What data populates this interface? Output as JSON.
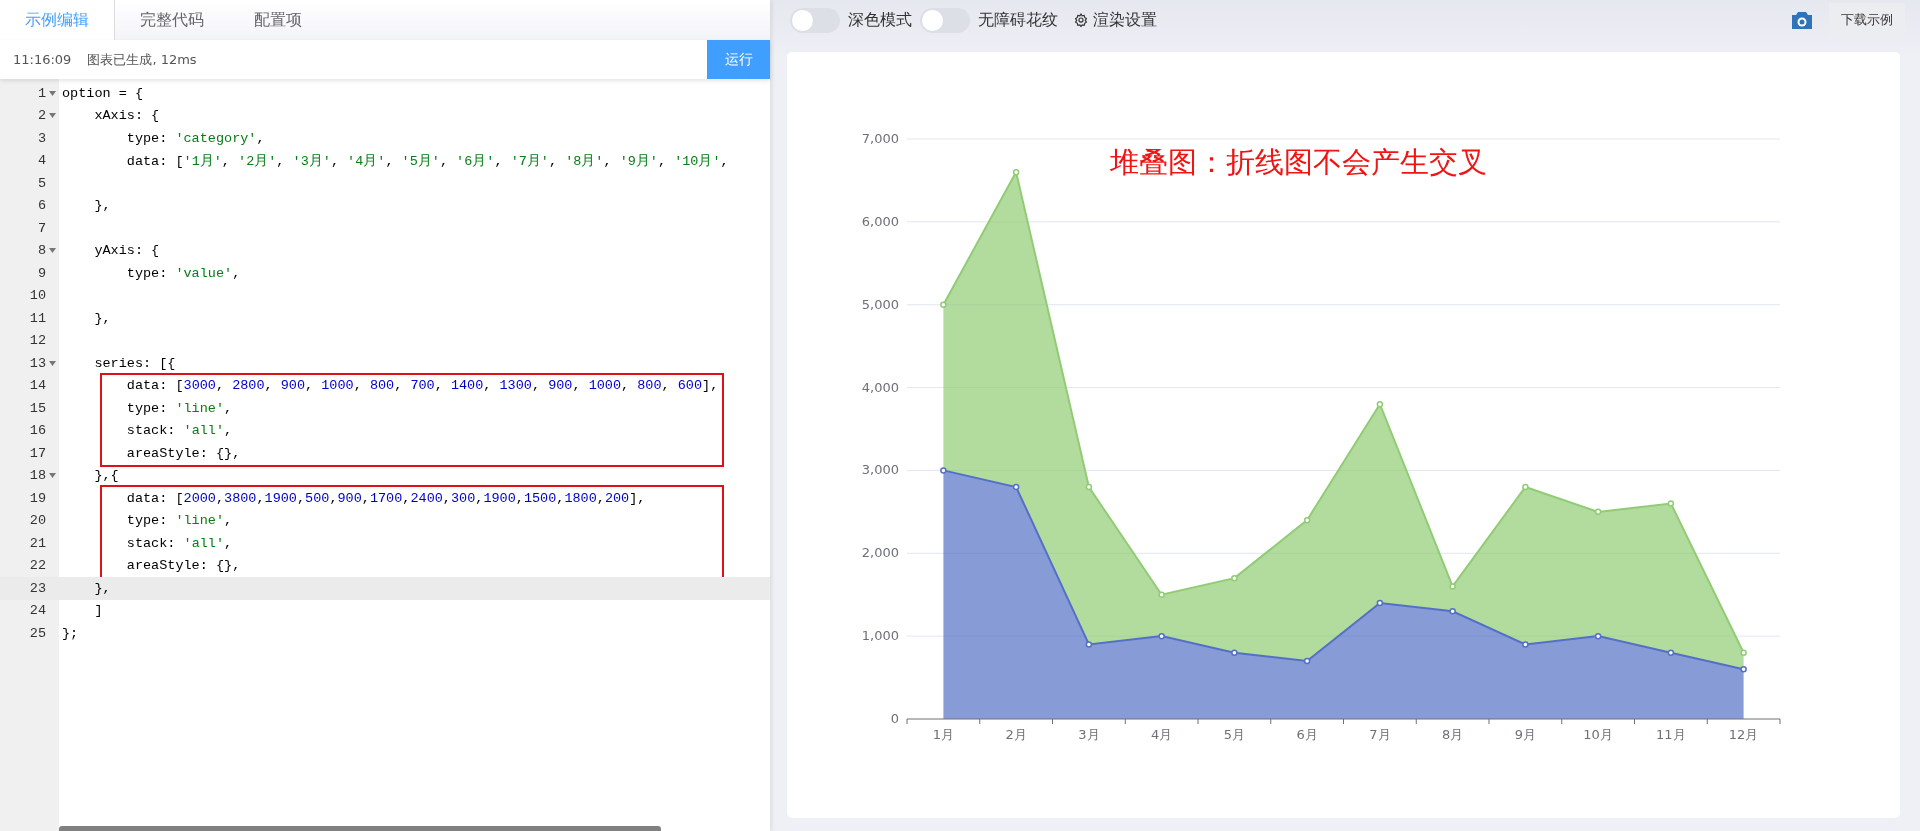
{
  "editor_tabs": [
    {
      "label": "示例编辑",
      "selected": true
    },
    {
      "label": "完整代码",
      "selected": false
    },
    {
      "label": "配置项",
      "selected": false
    }
  ],
  "status": {
    "time": "11:16:09",
    "message": "图表已生成, 12ms"
  },
  "run_button": "运行",
  "code_blocks": [
    {
      "boxed": false,
      "lines": [
        {
          "number": "1",
          "text": "option = {",
          "foldable": true,
          "current": false
        },
        {
          "number": "2",
          "text": "    xAxis: {",
          "foldable": true,
          "current": false
        },
        {
          "number": "3",
          "text": "        type: 'category',",
          "foldable": false,
          "current": false
        },
        {
          "number": "4",
          "text": "        data: ['1月', '2月', '3月', '4月', '5月', '6月', '7月', '8月', '9月', '10月',",
          "foldable": false,
          "current": false
        },
        {
          "number": "5",
          "foldable": false,
          "current": false
        },
        {
          "number": "6",
          "text": "    },",
          "foldable": false,
          "current": false
        },
        {
          "number": "7",
          "foldable": false,
          "current": false
        },
        {
          "number": "8",
          "text": "    yAxis: {",
          "foldable": true,
          "current": false
        },
        {
          "number": "9",
          "text": "        type: 'value',",
          "foldable": false,
          "current": false
        },
        {
          "number": "10",
          "foldable": false,
          "current": false
        },
        {
          "number": "11",
          "text": "    },",
          "foldable": false,
          "current": false
        },
        {
          "number": "12",
          "foldable": false,
          "current": false
        },
        {
          "number": "13",
          "text": "    series: [{",
          "foldable": true,
          "current": false
        }
      ]
    },
    {
      "boxed": true,
      "lines": [
        {
          "number": "14",
          "text": "        data: [3000, 2800, 900, 1000, 800, 700, 1400, 1300, 900, 1000, 800, 600],",
          "foldable": false,
          "current": false
        },
        {
          "number": "15",
          "text": "        type: 'line',",
          "foldable": false,
          "current": false
        },
        {
          "number": "16",
          "text": "        stack: 'all',",
          "foldable": false,
          "current": false
        },
        {
          "number": "17",
          "text": "        areaStyle: {},",
          "foldable": false,
          "current": false
        }
      ]
    },
    {
      "boxed": false,
      "lines": [
        {
          "number": "18",
          "text": "    },{",
          "foldable": true,
          "current": false
        }
      ]
    },
    {
      "boxed": true,
      "lines": [
        {
          "number": "19",
          "text": "        data: [2000,3800,1900,500,900,1700,2400,300,1900,1500,1800,200],",
          "foldable": false,
          "current": false
        },
        {
          "number": "20",
          "text": "        type: 'line',",
          "foldable": false,
          "current": false
        },
        {
          "number": "21",
          "text": "        stack: 'all',",
          "foldable": false,
          "current": false
        },
        {
          "number": "22",
          "text": "        areaStyle: {},",
          "foldable": false,
          "current": false
        }
      ]
    },
    {
      "boxed": false,
      "lines": [
        {
          "number": "23",
          "text": "    },",
          "foldable": false,
          "current": true
        },
        {
          "number": "24",
          "text": "    ]",
          "foldable": false,
          "current": false
        },
        {
          "number": "25",
          "text": "};",
          "foldable": false,
          "current": false
        }
      ]
    }
  ],
  "toolbar": {
    "toggles": [
      {
        "label": "深色模式",
        "on": false
      },
      {
        "label": "无障碍花纹",
        "on": false
      }
    ],
    "render_settings": "渲染设置",
    "download_button": "下载示例"
  },
  "chart_data": {
    "type": "area",
    "title": "堆叠图：折线图不会产生交叉",
    "stacked": true,
    "grid": true,
    "categories": [
      "1月",
      "2月",
      "3月",
      "4月",
      "5月",
      "6月",
      "7月",
      "8月",
      "9月",
      "10月",
      "11月",
      "12月"
    ],
    "series": [
      {
        "color": "#5470c6",
        "values": [
          3000,
          2800,
          900,
          1000,
          800,
          700,
          1400,
          1300,
          900,
          1000,
          800,
          600
        ]
      },
      {
        "color": "#91cc75",
        "values": [
          2000,
          3800,
          1900,
          500,
          900,
          1700,
          2400,
          300,
          1900,
          1500,
          1800,
          200
        ]
      }
    ],
    "ylim": [
      0,
      7000
    ],
    "yticks": [
      {
        "value": 0,
        "label": "0"
      },
      {
        "value": 1000,
        "label": "1,000"
      },
      {
        "value": 2000,
        "label": "2,000"
      },
      {
        "value": 3000,
        "label": "3,000"
      },
      {
        "value": 4000,
        "label": "4,000"
      },
      {
        "value": 5000,
        "label": "5,000"
      },
      {
        "value": 6000,
        "label": "6,000"
      },
      {
        "value": 7000,
        "label": "7,000"
      }
    ]
  }
}
